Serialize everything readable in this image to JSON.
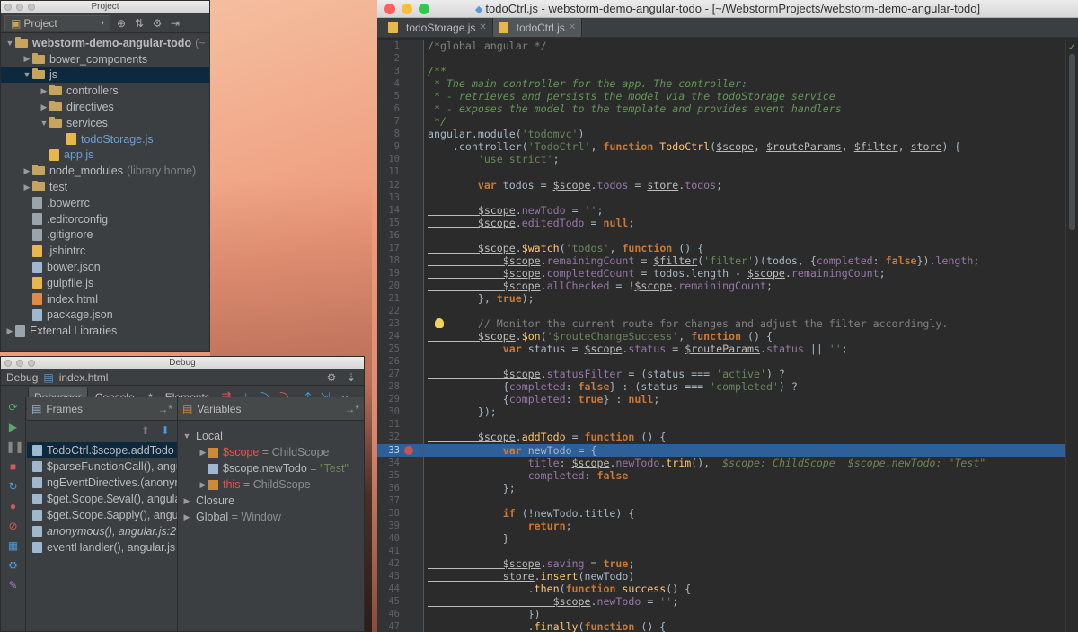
{
  "project": {
    "window_title": "Project",
    "selector": "Project",
    "tree": [
      {
        "label": "webstorm-demo-angular-todo",
        "suffix": "(~",
        "type": "folder",
        "indent": 0,
        "arrow": "down",
        "bold": true
      },
      {
        "label": "bower_components",
        "type": "folder",
        "indent": 1,
        "arrow": "right"
      },
      {
        "label": "js",
        "type": "folder",
        "indent": 1,
        "arrow": "down",
        "selected": true
      },
      {
        "label": "controllers",
        "type": "folder",
        "indent": 2,
        "arrow": "right"
      },
      {
        "label": "directives",
        "type": "folder",
        "indent": 2,
        "arrow": "right"
      },
      {
        "label": "services",
        "type": "folder",
        "indent": 2,
        "arrow": "down"
      },
      {
        "label": "todoStorage.js",
        "type": "js",
        "indent": 3,
        "arrow": "",
        "color": "blue"
      },
      {
        "label": "app.js",
        "type": "js",
        "indent": 2,
        "arrow": "",
        "color": "blue"
      },
      {
        "label": "node_modules",
        "suffix": "(library home)",
        "type": "folder",
        "indent": 1,
        "arrow": "right",
        "dim": true
      },
      {
        "label": "test",
        "type": "folder",
        "indent": 1,
        "arrow": "right"
      },
      {
        "label": ".bowerrc",
        "type": "gray",
        "indent": 1,
        "arrow": ""
      },
      {
        "label": ".editorconfig",
        "type": "gray",
        "indent": 1,
        "arrow": ""
      },
      {
        "label": ".gitignore",
        "type": "gray",
        "indent": 1,
        "arrow": ""
      },
      {
        "label": ".jshintrc",
        "type": "js",
        "indent": 1,
        "arrow": ""
      },
      {
        "label": "bower.json",
        "type": "json",
        "indent": 1,
        "arrow": ""
      },
      {
        "label": "gulpfile.js",
        "type": "js",
        "indent": 1,
        "arrow": ""
      },
      {
        "label": "index.html",
        "type": "html",
        "indent": 1,
        "arrow": ""
      },
      {
        "label": "package.json",
        "type": "json",
        "indent": 1,
        "arrow": ""
      },
      {
        "label": "External Libraries",
        "type": "gray",
        "indent": 0,
        "arrow": "right"
      }
    ]
  },
  "debug": {
    "window_title": "Debug",
    "run_label": "Debug",
    "run_config": "index.html",
    "tabs": [
      "Debugger",
      "Console",
      "Elements"
    ],
    "tab_suffix": "→*",
    "frames_title": "Frames",
    "variables_title": "Variables",
    "frames": [
      "TodoCtrl.$scope.addTodo",
      "$parseFunctionCall(), angu",
      "ngEventDirectives.(anonym",
      "$get.Scope.$eval(), angula",
      "$get.Scope.$apply(), angu",
      "anonymous(), angular.js:2",
      "eventHandler(), angular.js"
    ],
    "variables": {
      "local_label": "Local",
      "items": [
        {
          "name": "$scope",
          "sep": " = ",
          "value": "ChildScope"
        },
        {
          "name": "$scope.newTodo",
          "sep": " = ",
          "value": "\"Test\""
        },
        {
          "name": "this",
          "sep": " = ",
          "value": "ChildScope"
        }
      ],
      "closure_label": "Closure",
      "global_label": "Global",
      "global_value": "Window"
    }
  },
  "editor": {
    "window_title": "todoCtrl.js - webstorm-demo-angular-todo - [~/WebstormProjects/webstorm-demo-angular-todo]",
    "tabs": [
      "todoStorage.js",
      "todoCtrl.js"
    ],
    "active_tab": 1,
    "breakpoint_line": 33,
    "current_line": 33,
    "bulb_line": 23,
    "line_numbers": [
      "1",
      "2",
      "3",
      "4",
      "5",
      "6",
      "7",
      "8",
      "9",
      "10",
      "11",
      "12",
      "13",
      "14",
      "15",
      "16",
      "17",
      "18",
      "19",
      "20",
      "21",
      "22",
      "23",
      "24",
      "25",
      "26",
      "27",
      "28",
      "29",
      "30",
      "31",
      "32",
      "33",
      "34",
      "35",
      "36",
      "37",
      "38",
      "39",
      "40",
      "41",
      "42",
      "43",
      "44",
      "45",
      "46",
      "47"
    ],
    "lines": [
      [
        [
          "cm",
          "/*global angular */"
        ]
      ],
      [],
      [
        [
          "c",
          "/**"
        ]
      ],
      [
        [
          "c",
          " * The main controller for the app. The controller:"
        ]
      ],
      [
        [
          "c",
          " * - retrieves and persists the model via the todoStorage service"
        ]
      ],
      [
        [
          "c",
          " * - exposes the model to the template and provides event handlers"
        ]
      ],
      [
        [
          "c",
          " */"
        ]
      ],
      [
        [
          "tx",
          "angular.module("
        ],
        [
          "s",
          "'todomvc'"
        ],
        [
          "tx",
          ")"
        ]
      ],
      [
        [
          "tx",
          "    .controller("
        ],
        [
          "s",
          "'TodoCtrl'"
        ],
        [
          "tx",
          ", "
        ],
        [
          "k",
          "function "
        ],
        [
          "f",
          "TodoCtrl"
        ],
        [
          "tx",
          "("
        ],
        [
          "u",
          "$scope"
        ],
        [
          "tx",
          ", "
        ],
        [
          "u",
          "$routeParams"
        ],
        [
          "tx",
          ", "
        ],
        [
          "u",
          "$filter"
        ],
        [
          "tx",
          ", "
        ],
        [
          "u",
          "store"
        ],
        [
          "tx",
          ") {"
        ]
      ],
      [
        [
          "s",
          "        'use strict'"
        ],
        [
          "tx",
          ";"
        ]
      ],
      [],
      [
        [
          "k",
          "        var "
        ],
        [
          "tx",
          "todos = "
        ],
        [
          "u",
          "$scope"
        ],
        [
          "tx",
          "."
        ],
        [
          "p",
          "todos"
        ],
        [
          "tx",
          " = "
        ],
        [
          "u",
          "store"
        ],
        [
          "tx",
          "."
        ],
        [
          "p",
          "todos"
        ],
        [
          "tx",
          ";"
        ]
      ],
      [],
      [
        [
          "u",
          "        $scope"
        ],
        [
          "tx",
          "."
        ],
        [
          "p",
          "newTodo"
        ],
        [
          "tx",
          " = "
        ],
        [
          "s",
          "''"
        ],
        [
          "tx",
          ";"
        ]
      ],
      [
        [
          "u",
          "        $scope"
        ],
        [
          "tx",
          "."
        ],
        [
          "p",
          "editedTodo"
        ],
        [
          "tx",
          " = "
        ],
        [
          "k",
          "null"
        ],
        [
          "tx",
          ";"
        ]
      ],
      [],
      [
        [
          "u",
          "        $scope"
        ],
        [
          "tx",
          "."
        ],
        [
          "f",
          "$watch"
        ],
        [
          "tx",
          "("
        ],
        [
          "s",
          "'todos'"
        ],
        [
          "tx",
          ", "
        ],
        [
          "k",
          "function "
        ],
        [
          "tx",
          "() {"
        ]
      ],
      [
        [
          "u",
          "            $scope"
        ],
        [
          "tx",
          "."
        ],
        [
          "p",
          "remainingCount"
        ],
        [
          "tx",
          " = "
        ],
        [
          "u",
          "$filter"
        ],
        [
          "tx",
          "("
        ],
        [
          "s",
          "'filter'"
        ],
        [
          "tx",
          ")(todos, {"
        ],
        [
          "p",
          "completed"
        ],
        [
          "tx",
          ": "
        ],
        [
          "k",
          "false"
        ],
        [
          "tx",
          "})."
        ],
        [
          "p",
          "length"
        ],
        [
          "tx",
          ";"
        ]
      ],
      [
        [
          "u",
          "            $scope"
        ],
        [
          "tx",
          "."
        ],
        [
          "p",
          "completedCount"
        ],
        [
          "tx",
          " = todos.length - "
        ],
        [
          "u",
          "$scope"
        ],
        [
          "tx",
          "."
        ],
        [
          "p",
          "remainingCount"
        ],
        [
          "tx",
          ";"
        ]
      ],
      [
        [
          "u",
          "            $scope"
        ],
        [
          "tx",
          "."
        ],
        [
          "p",
          "allChecked"
        ],
        [
          "tx",
          " = !"
        ],
        [
          "u",
          "$scope"
        ],
        [
          "tx",
          "."
        ],
        [
          "p",
          "remainingCount"
        ],
        [
          "tx",
          ";"
        ]
      ],
      [
        [
          "tx",
          "        }, "
        ],
        [
          "k",
          "true"
        ],
        [
          "tx",
          ");"
        ]
      ],
      [],
      [
        [
          "cm",
          "        // Monitor the current route for changes and adjust the filter accordingly."
        ]
      ],
      [
        [
          "u",
          "        $scope"
        ],
        [
          "tx",
          "."
        ],
        [
          "f",
          "$on"
        ],
        [
          "tx",
          "("
        ],
        [
          "s",
          "'$routeChangeSuccess'"
        ],
        [
          "tx",
          ", "
        ],
        [
          "k",
          "function "
        ],
        [
          "tx",
          "() {"
        ]
      ],
      [
        [
          "k",
          "            var "
        ],
        [
          "tx",
          "status = "
        ],
        [
          "u",
          "$scope"
        ],
        [
          "tx",
          "."
        ],
        [
          "p",
          "status"
        ],
        [
          "tx",
          " = "
        ],
        [
          "u",
          "$routeParams"
        ],
        [
          "tx",
          "."
        ],
        [
          "p",
          "status"
        ],
        [
          "tx",
          " || "
        ],
        [
          "s",
          "''"
        ],
        [
          "tx",
          ";"
        ]
      ],
      [],
      [
        [
          "u",
          "            $scope"
        ],
        [
          "tx",
          "."
        ],
        [
          "p",
          "statusFilter"
        ],
        [
          "tx",
          " = (status === "
        ],
        [
          "s",
          "'active'"
        ],
        [
          "tx",
          ") ?"
        ]
      ],
      [
        [
          "tx",
          "            {"
        ],
        [
          "p",
          "completed"
        ],
        [
          "tx",
          ": "
        ],
        [
          "k",
          "false"
        ],
        [
          "tx",
          "} : (status === "
        ],
        [
          "s",
          "'completed'"
        ],
        [
          "tx",
          ") ?"
        ]
      ],
      [
        [
          "tx",
          "            {"
        ],
        [
          "p",
          "completed"
        ],
        [
          "tx",
          ": "
        ],
        [
          "k",
          "true"
        ],
        [
          "tx",
          "} : "
        ],
        [
          "k",
          "null"
        ],
        [
          "tx",
          ";"
        ]
      ],
      [
        [
          "tx",
          "        });"
        ]
      ],
      [],
      [
        [
          "u",
          "        $scope"
        ],
        [
          "tx",
          "."
        ],
        [
          "f",
          "addTodo"
        ],
        [
          "tx",
          " = "
        ],
        [
          "k",
          "function "
        ],
        [
          "tx",
          "() {"
        ]
      ],
      [
        [
          "k",
          "            var "
        ],
        [
          "tx",
          "newTodo = {"
        ]
      ],
      [
        [
          "tx",
          "                "
        ],
        [
          "p",
          "title"
        ],
        [
          "tx",
          ": "
        ],
        [
          "u",
          "$scope"
        ],
        [
          "tx",
          "."
        ],
        [
          "p",
          "newTodo"
        ],
        [
          "tx",
          "."
        ],
        [
          "f",
          "trim"
        ],
        [
          "tx",
          "(),  "
        ],
        [
          "inl",
          "$scope: ChildScope  $scope.newTodo: \"Test\""
        ]
      ],
      [
        [
          "tx",
          "                "
        ],
        [
          "p",
          "completed"
        ],
        [
          "tx",
          ": "
        ],
        [
          "k",
          "false"
        ]
      ],
      [
        [
          "tx",
          "            };"
        ]
      ],
      [],
      [
        [
          "k",
          "            if "
        ],
        [
          "tx",
          "(!newTodo.title) {"
        ]
      ],
      [
        [
          "k",
          "                return"
        ],
        [
          "tx",
          ";"
        ]
      ],
      [
        [
          "tx",
          "            }"
        ]
      ],
      [],
      [
        [
          "u",
          "            $scope"
        ],
        [
          "tx",
          "."
        ],
        [
          "p",
          "saving"
        ],
        [
          "tx",
          " = "
        ],
        [
          "k",
          "true"
        ],
        [
          "tx",
          ";"
        ]
      ],
      [
        [
          "u",
          "            store"
        ],
        [
          "tx",
          "."
        ],
        [
          "f",
          "insert"
        ],
        [
          "tx",
          "(newTodo)"
        ]
      ],
      [
        [
          "tx",
          "                ."
        ],
        [
          "f",
          "then"
        ],
        [
          "tx",
          "("
        ],
        [
          "k",
          "function "
        ],
        [
          "f",
          "success"
        ],
        [
          "tx",
          "() {"
        ]
      ],
      [
        [
          "u",
          "                    $scope"
        ],
        [
          "tx",
          "."
        ],
        [
          "p",
          "newTodo"
        ],
        [
          "tx",
          " = "
        ],
        [
          "s",
          "''"
        ],
        [
          "tx",
          ";"
        ]
      ],
      [
        [
          "tx",
          "                })"
        ]
      ],
      [
        [
          "tx",
          "                ."
        ],
        [
          "f",
          "finally"
        ],
        [
          "tx",
          "("
        ],
        [
          "k",
          "function "
        ],
        [
          "tx",
          "() {"
        ]
      ]
    ]
  }
}
